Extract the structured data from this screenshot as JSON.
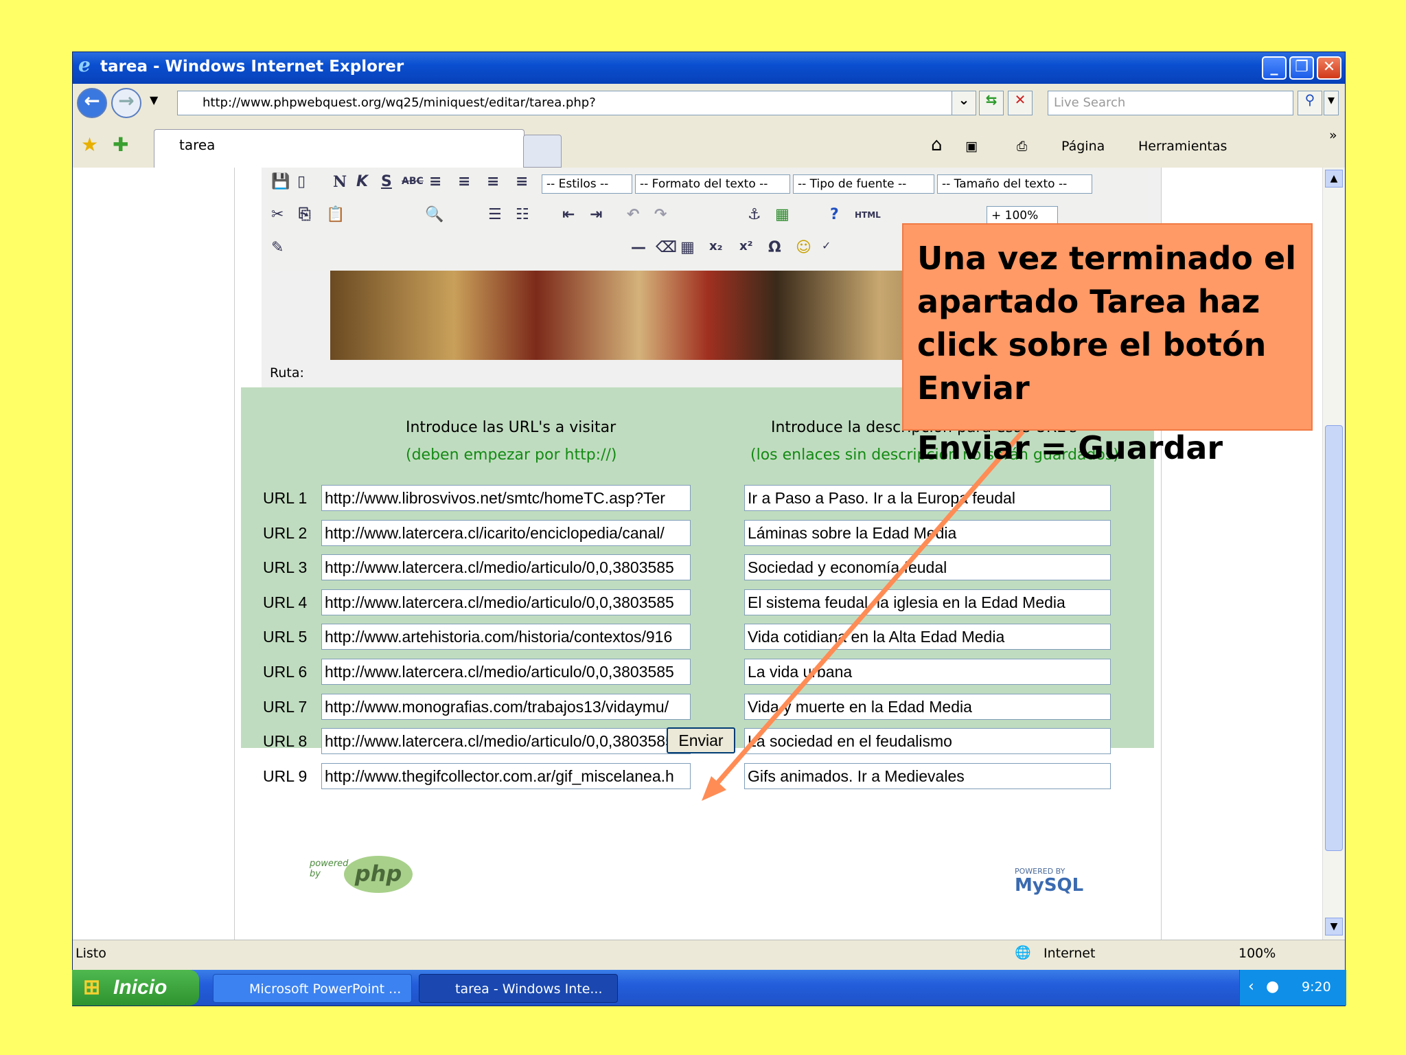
{
  "window": {
    "title": "tarea - Windows Internet Explorer",
    "address": "http://www.phpwebquest.org/wq25/miniquest/editar/tarea.php?",
    "search_placeholder": "Live Search",
    "tab_label": "tarea",
    "toolbar": {
      "pagina": "Página",
      "herramientas": "Herramientas"
    }
  },
  "editor": {
    "select_estilos": "-- Estilos --",
    "select_formato": "-- Formato del texto --",
    "select_fuente": "-- Tipo de fuente --",
    "select_tamano": "-- Tamaño del texto --",
    "zoom": "+ 100%",
    "ruta_label": "Ruta:"
  },
  "form": {
    "left_header": "Introduce las URL's a visitar",
    "left_sub": "(deben empezar por http://)",
    "right_header": "Introduce la descripción para esas URL's",
    "right_sub": "(los enlaces sin descripción no serán guardados)",
    "rows": [
      {
        "label": "URL 1",
        "url": "http://www.librosvivos.net/smtc/homeTC.asp?Ter",
        "desc": "Ir a Paso a Paso. Ir a la Europa feudal"
      },
      {
        "label": "URL 2",
        "url": "http://www.latercera.cl/icarito/enciclopedia/canal/",
        "desc": "Láminas sobre la Edad Media"
      },
      {
        "label": "URL 3",
        "url": "http://www.latercera.cl/medio/articulo/0,0,3803585",
        "desc": "Sociedad y economía feudal"
      },
      {
        "label": "URL 4",
        "url": "http://www.latercera.cl/medio/articulo/0,0,3803585",
        "desc": "El sistema feudal, la iglesia en la Edad Media"
      },
      {
        "label": "URL 5",
        "url": "http://www.artehistoria.com/historia/contextos/916",
        "desc": "Vida cotidiana en la Alta Edad Media"
      },
      {
        "label": "URL 6",
        "url": "http://www.latercera.cl/medio/articulo/0,0,3803585",
        "desc": "La vida urbana"
      },
      {
        "label": "URL 7",
        "url": "http://www.monografias.com/trabajos13/vidaymu/",
        "desc": "Vida y muerte en la Edad Media"
      },
      {
        "label": "URL 8",
        "url": "http://www.latercera.cl/medio/articulo/0,0,3803585",
        "desc": "La sociedad en el feudalismo"
      },
      {
        "label": "URL 9",
        "url": "http://www.thegifcollector.com.ar/gif_miscelanea.h",
        "desc": "Gifs animados. Ir a Medievales"
      }
    ],
    "submit_label": "Enviar"
  },
  "footer": {
    "php_powered": "powered by",
    "php_text": "php",
    "mysql_powered": "POWERED BY",
    "mysql_text": "MySQL"
  },
  "status": {
    "text": "Listo",
    "zone": "Internet",
    "zoom": "100%"
  },
  "taskbar": {
    "start": "Inicio",
    "tasks": [
      "Microsoft PowerPoint ...",
      "tarea - Windows Inte..."
    ],
    "clock": "9:20"
  },
  "callout": {
    "line1": "Una vez terminado el apartado Tarea haz click sobre el botón Enviar",
    "line2": "Enviar = Guardar"
  },
  "colors": {
    "slide_bg": "#ffff66",
    "callout_bg": "#ff9966",
    "arrow": "#ff8c55",
    "form_bg": "#c0dcc0",
    "hint_green": "#138a13"
  }
}
